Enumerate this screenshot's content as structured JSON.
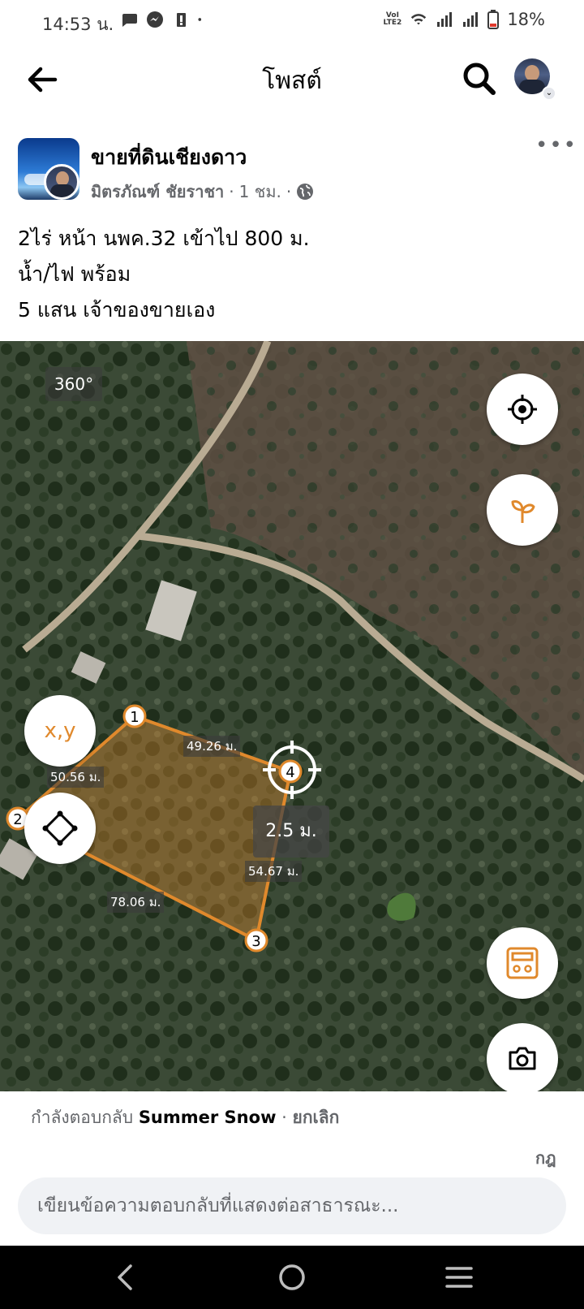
{
  "status_bar": {
    "time": "14:53 น.",
    "battery": "18%",
    "network_label_top": "VoI",
    "network_label_bottom": "LTE2"
  },
  "header": {
    "title": "โพสต์"
  },
  "post": {
    "group_name": "ขายที่ดินเชียงดาว",
    "author": "มิตรภัณฑ์ ชัยราชา",
    "time": "1 ชม.",
    "separator": "·",
    "text_lines": [
      "2ไร่ หน้า นพค.32 เข้าไป 800 ม.",
      "น้ำ/ไฟ พร้อม",
      "5 แสน เจ้าของขายเอง"
    ]
  },
  "map": {
    "label_360": "360°",
    "xy_label": "x,y",
    "distance_tag": "2.5 ม.",
    "points": [
      "1",
      "2",
      "3",
      "4"
    ],
    "measurements": {
      "side_1_4": "49.26 ม.",
      "side_1_2": "50.56 ม.",
      "side_4_3": "54.67 ม.",
      "side_2_3": "78.06 ม."
    },
    "accent_color": "#e0892c"
  },
  "reply": {
    "prefix": "กำลังตอบกลับ",
    "name": "Summer Snow",
    "separator": "·",
    "cancel": "ยกเลิก"
  },
  "sticker_label": "กฎ",
  "comment": {
    "placeholder": "เขียนข้อความตอบกลับที่แสดงต่อสาธารณะ..."
  },
  "colors": {
    "text_primary": "#050505",
    "text_secondary": "#65676b",
    "input_bg": "#f0f2f5",
    "map_accent": "#e0892c"
  }
}
